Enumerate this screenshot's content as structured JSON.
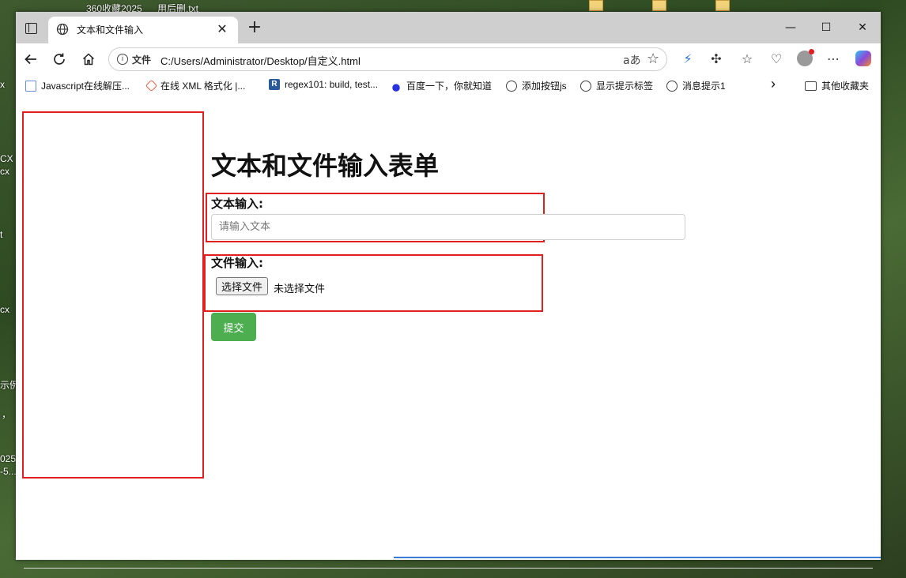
{
  "desktop": {
    "top_items": [
      "360收藏2025",
      "用后删.txt"
    ],
    "left_labels": [
      "x",
      "CX",
      "cx",
      "t",
      "cx",
      "示例",
      "，",
      "025-",
      "-5..."
    ]
  },
  "browser": {
    "tab": {
      "title": "文本和文件输入",
      "close": "✕"
    },
    "new_tab": "+",
    "window_controls": {
      "minimize": "—",
      "maximize": "☐",
      "close": "✕"
    },
    "address": {
      "info_icon": "i",
      "label": "文件",
      "url": "C:/Users/Administrator/Desktop/自定义.html",
      "read_aloud": "aあ"
    },
    "bookmarks": [
      {
        "label": "Javascript在线解压...",
        "icon": "js-file-icon"
      },
      {
        "label": "在线 XML 格式化 |...",
        "icon": "xml-icon"
      },
      {
        "label": "regex101: build, test...",
        "icon": "regex-r-icon"
      },
      {
        "label": "百度一下，你就知道",
        "icon": "baidu-paw-icon"
      },
      {
        "label": "添加按钮js",
        "icon": "globe-icon"
      },
      {
        "label": "显示提示标签",
        "icon": "globe-icon"
      },
      {
        "label": "消息提示1",
        "icon": "globe-icon"
      }
    ],
    "bookmarks_more": "›",
    "other_bookmarks": "其他收藏夹"
  },
  "page": {
    "title": "文本和文件输入表单",
    "text_label": "文本输入:",
    "text_placeholder": "请输入文本",
    "text_value": "",
    "file_label": "文件输入:",
    "file_button": "选择文件",
    "file_status": "未选择文件",
    "submit_label": "提交"
  },
  "colors": {
    "highlight_border": "#e02020",
    "submit_bg": "#4cae4f",
    "tabbar_bg": "#cfcfcf"
  }
}
